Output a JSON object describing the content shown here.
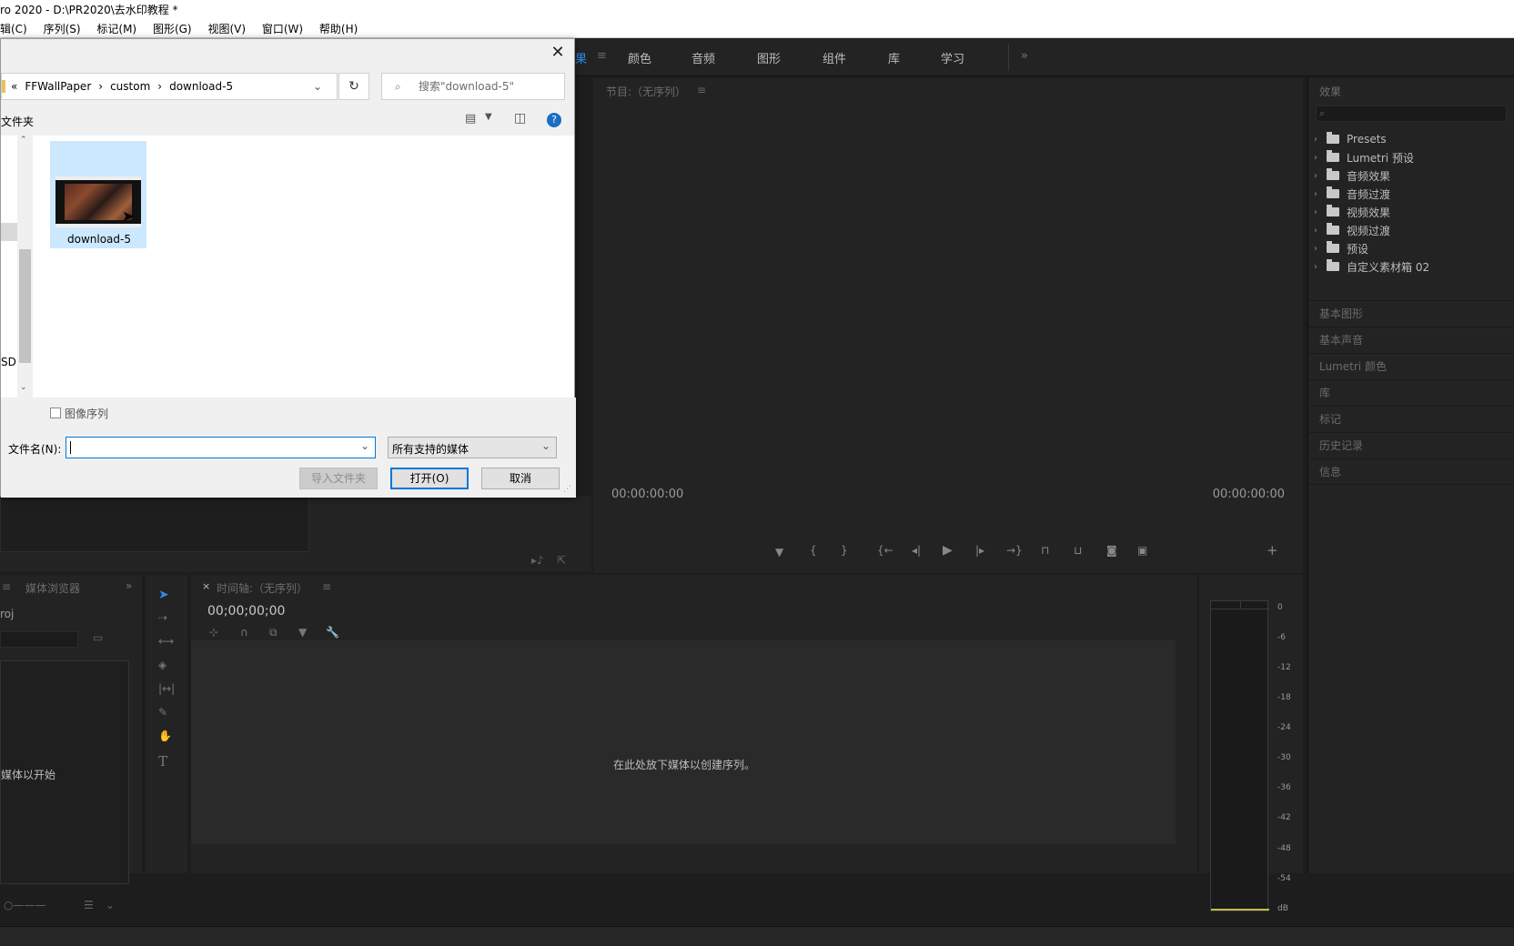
{
  "window": {
    "title": "ro 2020 - D:\\PR2020\\去水印教程 *"
  },
  "menu": [
    "辑(C)",
    "序列(S)",
    "标记(M)",
    "图形(G)",
    "视图(V)",
    "窗口(W)",
    "帮助(H)"
  ],
  "workspace_tabs": [
    "果",
    "颜色",
    "音频",
    "图形",
    "组件",
    "库",
    "学习"
  ],
  "program_monitor": {
    "title": "节目:（无序列）",
    "timecode_left": "00:00:00:00",
    "timecode_right": "00:00:00:00"
  },
  "effects": {
    "title": "效果",
    "items": [
      "Presets",
      "Lumetri 预设",
      "音频效果",
      "音频过渡",
      "视频效果",
      "视频过渡",
      "预设",
      "自定义素材箱 02"
    ],
    "sections": [
      "基本图形",
      "基本声音",
      "Lumetri 颜色",
      "库",
      "标记",
      "历史记录",
      "信息"
    ]
  },
  "project": {
    "tab": "媒体浏览器",
    "proj_name": "roj",
    "hint": "媒体以开始"
  },
  "timeline": {
    "title": "时间轴:（无序列）",
    "timecode": "00;00;00;00",
    "drop_hint": "在此处放下媒体以创建序列。"
  },
  "audio_meter": {
    "scale": [
      "0",
      "-6",
      "-12",
      "-18",
      "-24",
      "-30",
      "-36",
      "-42",
      "-48",
      "-54",
      "dB"
    ]
  },
  "dialog": {
    "breadcrumb": [
      "«",
      "FFWallPaper",
      "›",
      "custom",
      "›",
      "download-5"
    ],
    "search_placeholder": "搜索\"download-5\"",
    "toolbar_left": "文件夹",
    "nav_label": "SD",
    "file_name": "download-5",
    "image_sequence_label": "图像序列",
    "filename_label": "文件名(N):",
    "filename_value": "",
    "filetype_value": "所有支持的媒体",
    "import_folder_button": "导入文件夹",
    "open_button": "打开(O)",
    "cancel_button": "取消"
  }
}
